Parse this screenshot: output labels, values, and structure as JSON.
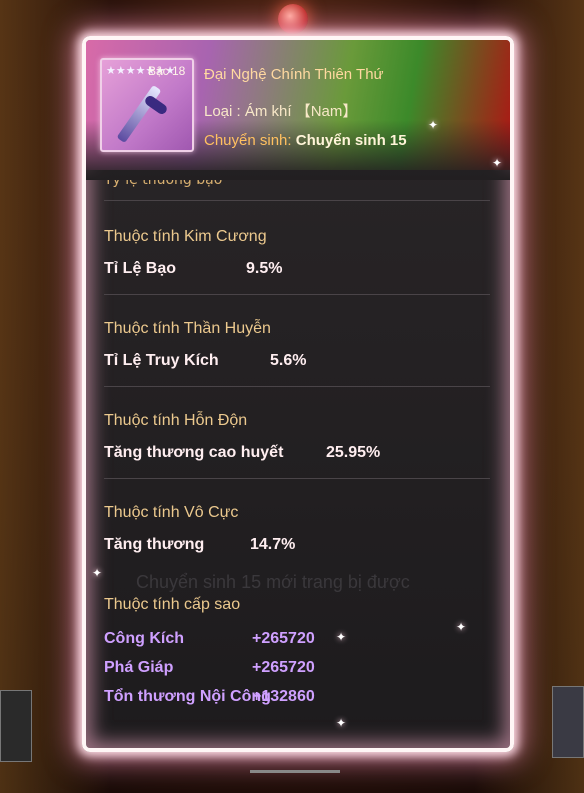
{
  "item": {
    "rank": "Bậc 18",
    "name": "Đại Nghệ Chính Thiên Thứ",
    "type": "Loại : Ám khí 【Nam】",
    "rebirth_label": "Chuyển   sinh:",
    "rebirth_value": "Chuyển sinh 15",
    "stars": "★★★★★★★"
  },
  "cut_text": "Tỷ lệ thương bạo",
  "sections": [
    {
      "title": "Thuộc tính Kim Cương",
      "stat": "Tỉ Lệ Bạo",
      "value": "9.5%"
    },
    {
      "title": "Thuộc tính Thần Huyễn",
      "stat": "Tỉ Lệ Truy Kích",
      "value": "5.6%"
    },
    {
      "title": "Thuộc tính Hỗn Độn",
      "stat": "Tăng thương cao huyết",
      "value": "25.95%"
    },
    {
      "title": "Thuộc tính Vô Cực",
      "stat": "Tăng thương",
      "value": "14.7%"
    }
  ],
  "star_section": {
    "title": "Thuộc tính cấp sao",
    "rows": [
      {
        "stat": "Công Kích",
        "value": "+265720"
      },
      {
        "stat": "Phá Giáp",
        "value": "+265720"
      },
      {
        "stat": "Tổn thương Nội Công",
        "value": "+132860"
      }
    ]
  },
  "background_text": "Chuyển sinh 15 mới trang bị được",
  "colors": {
    "frame_glow": "#ffe0e8",
    "section_title": "#ecc98e",
    "star_stats": "#cfa0ff"
  }
}
